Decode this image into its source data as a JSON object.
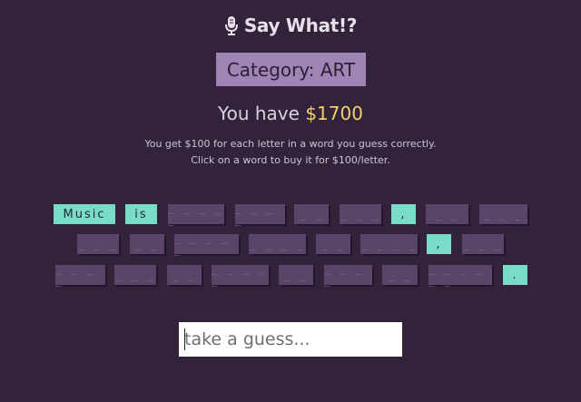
{
  "app": {
    "title": "Say What!?",
    "icon": "microphone-icon"
  },
  "category": {
    "label": "Category: ART"
  },
  "money": {
    "prefix": "You have",
    "amount": "$1700"
  },
  "instructions": {
    "line1": "You get $100 for each letter in a word you guess correctly.",
    "line2": "Click on a word to buy it for $100/letter."
  },
  "words": [
    {
      "text": "Music",
      "revealed": true
    },
    {
      "text": "is",
      "revealed": true
    },
    {
      "text": "_ _ _ _ _",
      "revealed": false
    },
    {
      "text": "_ _ _ _",
      "revealed": false
    },
    {
      "text": "_ _",
      "revealed": false
    },
    {
      "text": "_ _ _",
      "revealed": false
    },
    {
      "text": ",",
      "revealed": true
    },
    {
      "text": "_ _",
      "revealed": false
    },
    {
      "text": "_ _ _",
      "revealed": false
    },
    {
      "text": "_ _ _",
      "revealed": false
    },
    {
      "text": "_ _",
      "revealed": false
    },
    {
      "text": "_ _ _ _ _",
      "revealed": false
    },
    {
      "text": "_ _ _ _",
      "revealed": false
    },
    {
      "text": "_ _",
      "revealed": false
    },
    {
      "text": "_ _ _ _",
      "revealed": false
    },
    {
      "text": ",",
      "revealed": true
    },
    {
      "text": "_ _ _",
      "revealed": false
    },
    {
      "text": "_ _ _ _",
      "revealed": false
    },
    {
      "text": "_ _ _",
      "revealed": false
    },
    {
      "text": "_ _",
      "revealed": false
    },
    {
      "text": "_ _ _ _ _",
      "revealed": false
    },
    {
      "text": "_ _",
      "revealed": false
    },
    {
      "text": "_ _ _ _",
      "revealed": false
    },
    {
      "text": "_ _",
      "revealed": false
    },
    {
      "text": "_ _ _ _ _ _",
      "revealed": false
    },
    {
      "text": ".",
      "revealed": true
    }
  ],
  "guess": {
    "placeholder": "take a guess...",
    "value": ""
  },
  "colors": {
    "background": "#33233a",
    "category_bg": "#9f84b6",
    "revealed_word": "#78dcc9",
    "hidden_word": "#5b4469",
    "money_amount": "#f2d06b"
  }
}
